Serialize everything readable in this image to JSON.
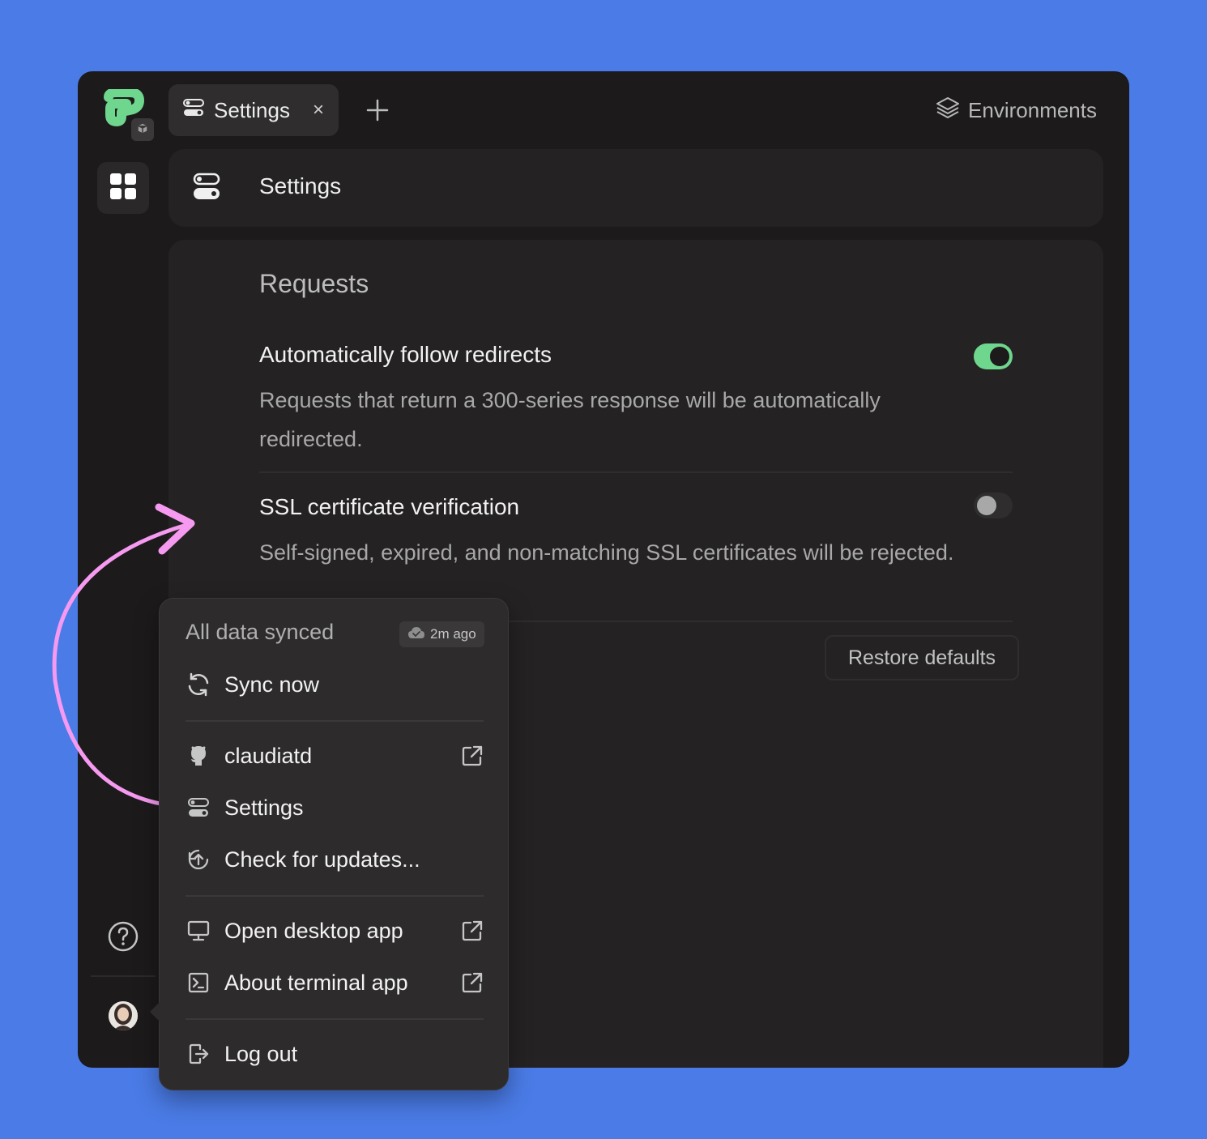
{
  "tabs": [
    {
      "label": "Settings",
      "close": "×"
    }
  ],
  "top_right": {
    "label": "Environments"
  },
  "header": {
    "title": "Settings"
  },
  "section": {
    "title": "Requests"
  },
  "settings": [
    {
      "title": "Automatically follow redirects",
      "description": "Requests that return a 300-series response will be automatically redirected.",
      "enabled": true
    },
    {
      "title": "SSL certificate verification",
      "description": "Self-signed, expired, and non-matching SSL certificates will be rejected.",
      "enabled": false
    }
  ],
  "restore_label": "Restore defaults",
  "menu": {
    "status": "All data synced",
    "badge": "2m ago",
    "sync_now": "Sync now",
    "username": "claudiatd",
    "settings": "Settings",
    "check_updates": "Check for updates...",
    "open_desktop": "Open desktop app",
    "about_terminal": "About terminal app",
    "log_out": "Log out"
  },
  "colors": {
    "background": "#4a7be6",
    "window": "#1c1a1a",
    "accent": "#6fd68d",
    "arrow": "#f59af0"
  }
}
